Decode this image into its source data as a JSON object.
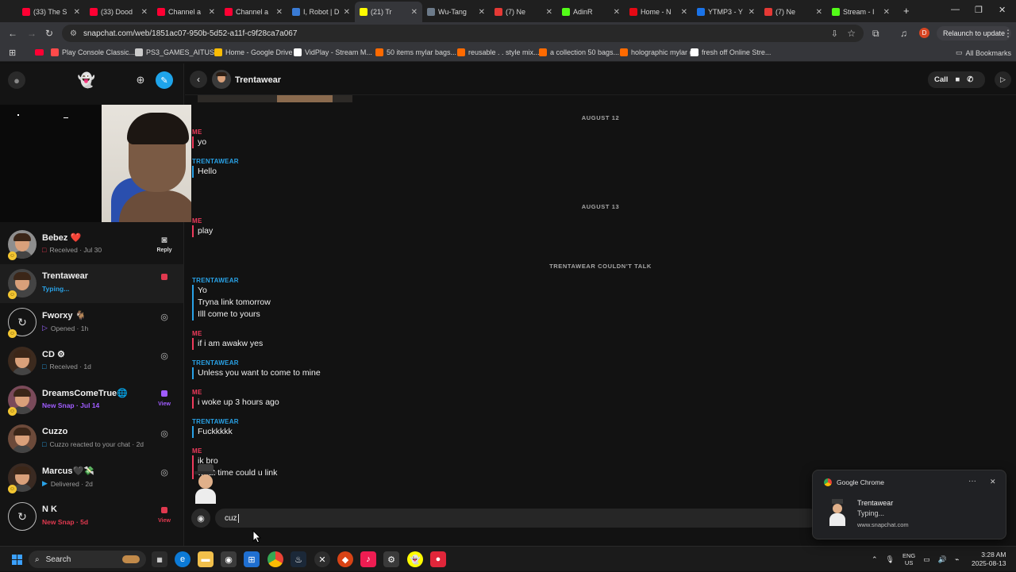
{
  "browser": {
    "tabs": [
      {
        "title": "(33) The S",
        "color": "#ff0033",
        "close": "✕"
      },
      {
        "title": "(33) Dood",
        "color": "#ff0033",
        "close": "✕"
      },
      {
        "title": "Channel a",
        "color": "#ff0033",
        "close": "✕"
      },
      {
        "title": "Channel a",
        "color": "#ff0033",
        "close": "✕"
      },
      {
        "title": "I, Robot | D",
        "color": "#3a7bd5",
        "close": "✕"
      },
      {
        "title": "(21) Tr",
        "color": "#fffc00",
        "close": "✕",
        "active": true
      },
      {
        "title": "Wu-Tang",
        "color": "#6c7a89",
        "close": "✕"
      },
      {
        "title": "(7) Ne",
        "color": "#e53935",
        "close": "✕"
      },
      {
        "title": "AdinR",
        "color": "#53fc18",
        "close": "✕"
      },
      {
        "title": "Home - N",
        "color": "#e50914",
        "close": "✕"
      },
      {
        "title": "YTMP3 - Y",
        "color": "#1a73e8",
        "close": "✕"
      },
      {
        "title": "(7) Ne",
        "color": "#e53935",
        "close": "✕"
      },
      {
        "title": "Stream - I",
        "color": "#53fc18",
        "close": "✕"
      }
    ],
    "new_tab": "+",
    "url": "snapchat.com/web/1851ac07-950b-5d52-a11f-c9f28ca7a067",
    "relaunch_label": "Relaunch to update",
    "profile_initial": "D",
    "bookmarks": [
      {
        "label": "Play Console Classic...",
        "color": "#ff4a4a"
      },
      {
        "label": "PS3_GAMES_AITUS...",
        "color": "#cccccc"
      },
      {
        "label": "Home - Google Drive",
        "color": "#fbbc04"
      },
      {
        "label": "VidPlay - Stream M...",
        "color": "#ffffff"
      },
      {
        "label": "50 items mylar bags...",
        "color": "#ff6a00"
      },
      {
        "label": "reusable . . style mix...",
        "color": "#ff6a00"
      },
      {
        "label": "a collection 50 bags...",
        "color": "#ff6a00"
      },
      {
        "label": "holographic mylar g...",
        "color": "#ff6a00"
      },
      {
        "label": "fresh off Online Stre...",
        "color": "#ffffff"
      }
    ],
    "all_bookmarks": "All Bookmarks"
  },
  "sidebar": {
    "chats": [
      {
        "name": "Bebez ❤️",
        "status": "Received · Jul 30",
        "status_icon": "□",
        "status_color": "#e0394f",
        "action": "📷",
        "action_label": "Reply",
        "avatar_bg": "#8e8e8e"
      },
      {
        "name": "Trentawear",
        "status": "Typing...",
        "status_icon": "",
        "status_color": "#29a2e7",
        "action": "■",
        "action_color": "#e0394f",
        "avatar_bg": "#444444",
        "selected": true
      },
      {
        "name": "Fworxy 🐐",
        "status": "Opened · 1h",
        "status_icon": "▷",
        "status_color": "#9a64ff",
        "action": "◎",
        "avatar_bg": "ring"
      },
      {
        "name": "CD ⚙",
        "status": "Received · 1d",
        "status_icon": "□",
        "status_color": "#29a2e7",
        "action": "◎",
        "avatar_bg": "#3c2a1e"
      },
      {
        "name": "DreamsComeTrue🌐",
        "status": "New Snap · Jul 14",
        "status_icon": "",
        "status_color": "#a05cff",
        "action": "■",
        "action_color": "#a05cff",
        "action_label": "View",
        "avatar_bg": "#7a4a5a"
      },
      {
        "name": "Cuzzo",
        "status": "Cuzzo reacted to your chat · 2d",
        "status_icon": "□",
        "status_color": "#29a2e7",
        "action": "◎",
        "avatar_bg": "#6c4a3a"
      },
      {
        "name": "Marcus🖤💸",
        "status": "Delivered · 2d",
        "status_icon": "▶",
        "status_color": "#29a2e7",
        "action": "◎",
        "avatar_bg": "#3a2a22"
      },
      {
        "name": "N K",
        "status": "New Snap · 5d",
        "status_icon": "",
        "status_color": "#e0394f",
        "action": "■",
        "action_color": "#e0394f",
        "action_label": "View",
        "avatar_bg": "ring"
      }
    ]
  },
  "conversation": {
    "contact_name": "Trentawear",
    "call_label": "Call",
    "messages": [
      {
        "type": "date",
        "text": "AUGUST 12"
      },
      {
        "type": "msg",
        "from": "me",
        "sender": "ME",
        "lines": [
          "yo"
        ]
      },
      {
        "type": "msg",
        "from": "them",
        "sender": "TRENTAWEAR",
        "lines": [
          "Hello"
        ]
      },
      {
        "type": "date",
        "text": "AUGUST 13"
      },
      {
        "type": "msg",
        "from": "me",
        "sender": "ME",
        "lines": [
          "play"
        ]
      },
      {
        "type": "date",
        "text": "TRENTAWEAR COULDN'T TALK"
      },
      {
        "type": "msg",
        "from": "them",
        "sender": "TRENTAWEAR",
        "lines": [
          "Yo",
          "Tryna link tomorrow",
          "Illl come to yours"
        ]
      },
      {
        "type": "msg",
        "from": "me",
        "sender": "ME",
        "lines": [
          "if i am awakw yes"
        ]
      },
      {
        "type": "msg",
        "from": "them",
        "sender": "TRENTAWEAR",
        "lines": [
          "Unless you want to come to mine"
        ]
      },
      {
        "type": "msg",
        "from": "me",
        "sender": "ME",
        "lines": [
          "i woke up 3 hours ago"
        ]
      },
      {
        "type": "msg",
        "from": "them",
        "sender": "TRENTAWEAR",
        "lines": [
          "Fuckkkkk"
        ]
      },
      {
        "type": "msg",
        "from": "me",
        "sender": "ME",
        "lines": [
          "ik bro",
          "what time could u link"
        ]
      }
    ],
    "input_value": "cuz"
  },
  "notification": {
    "app": "Google Chrome",
    "title": "Trentawear",
    "body": "Typing...",
    "source": "www.snapchat.com",
    "menu": "···",
    "close": "✕"
  },
  "taskbar": {
    "search_label": "Search",
    "lang_top": "ENG",
    "lang_bottom": "US",
    "time": "3:28 AM",
    "date": "2025-08-13"
  }
}
